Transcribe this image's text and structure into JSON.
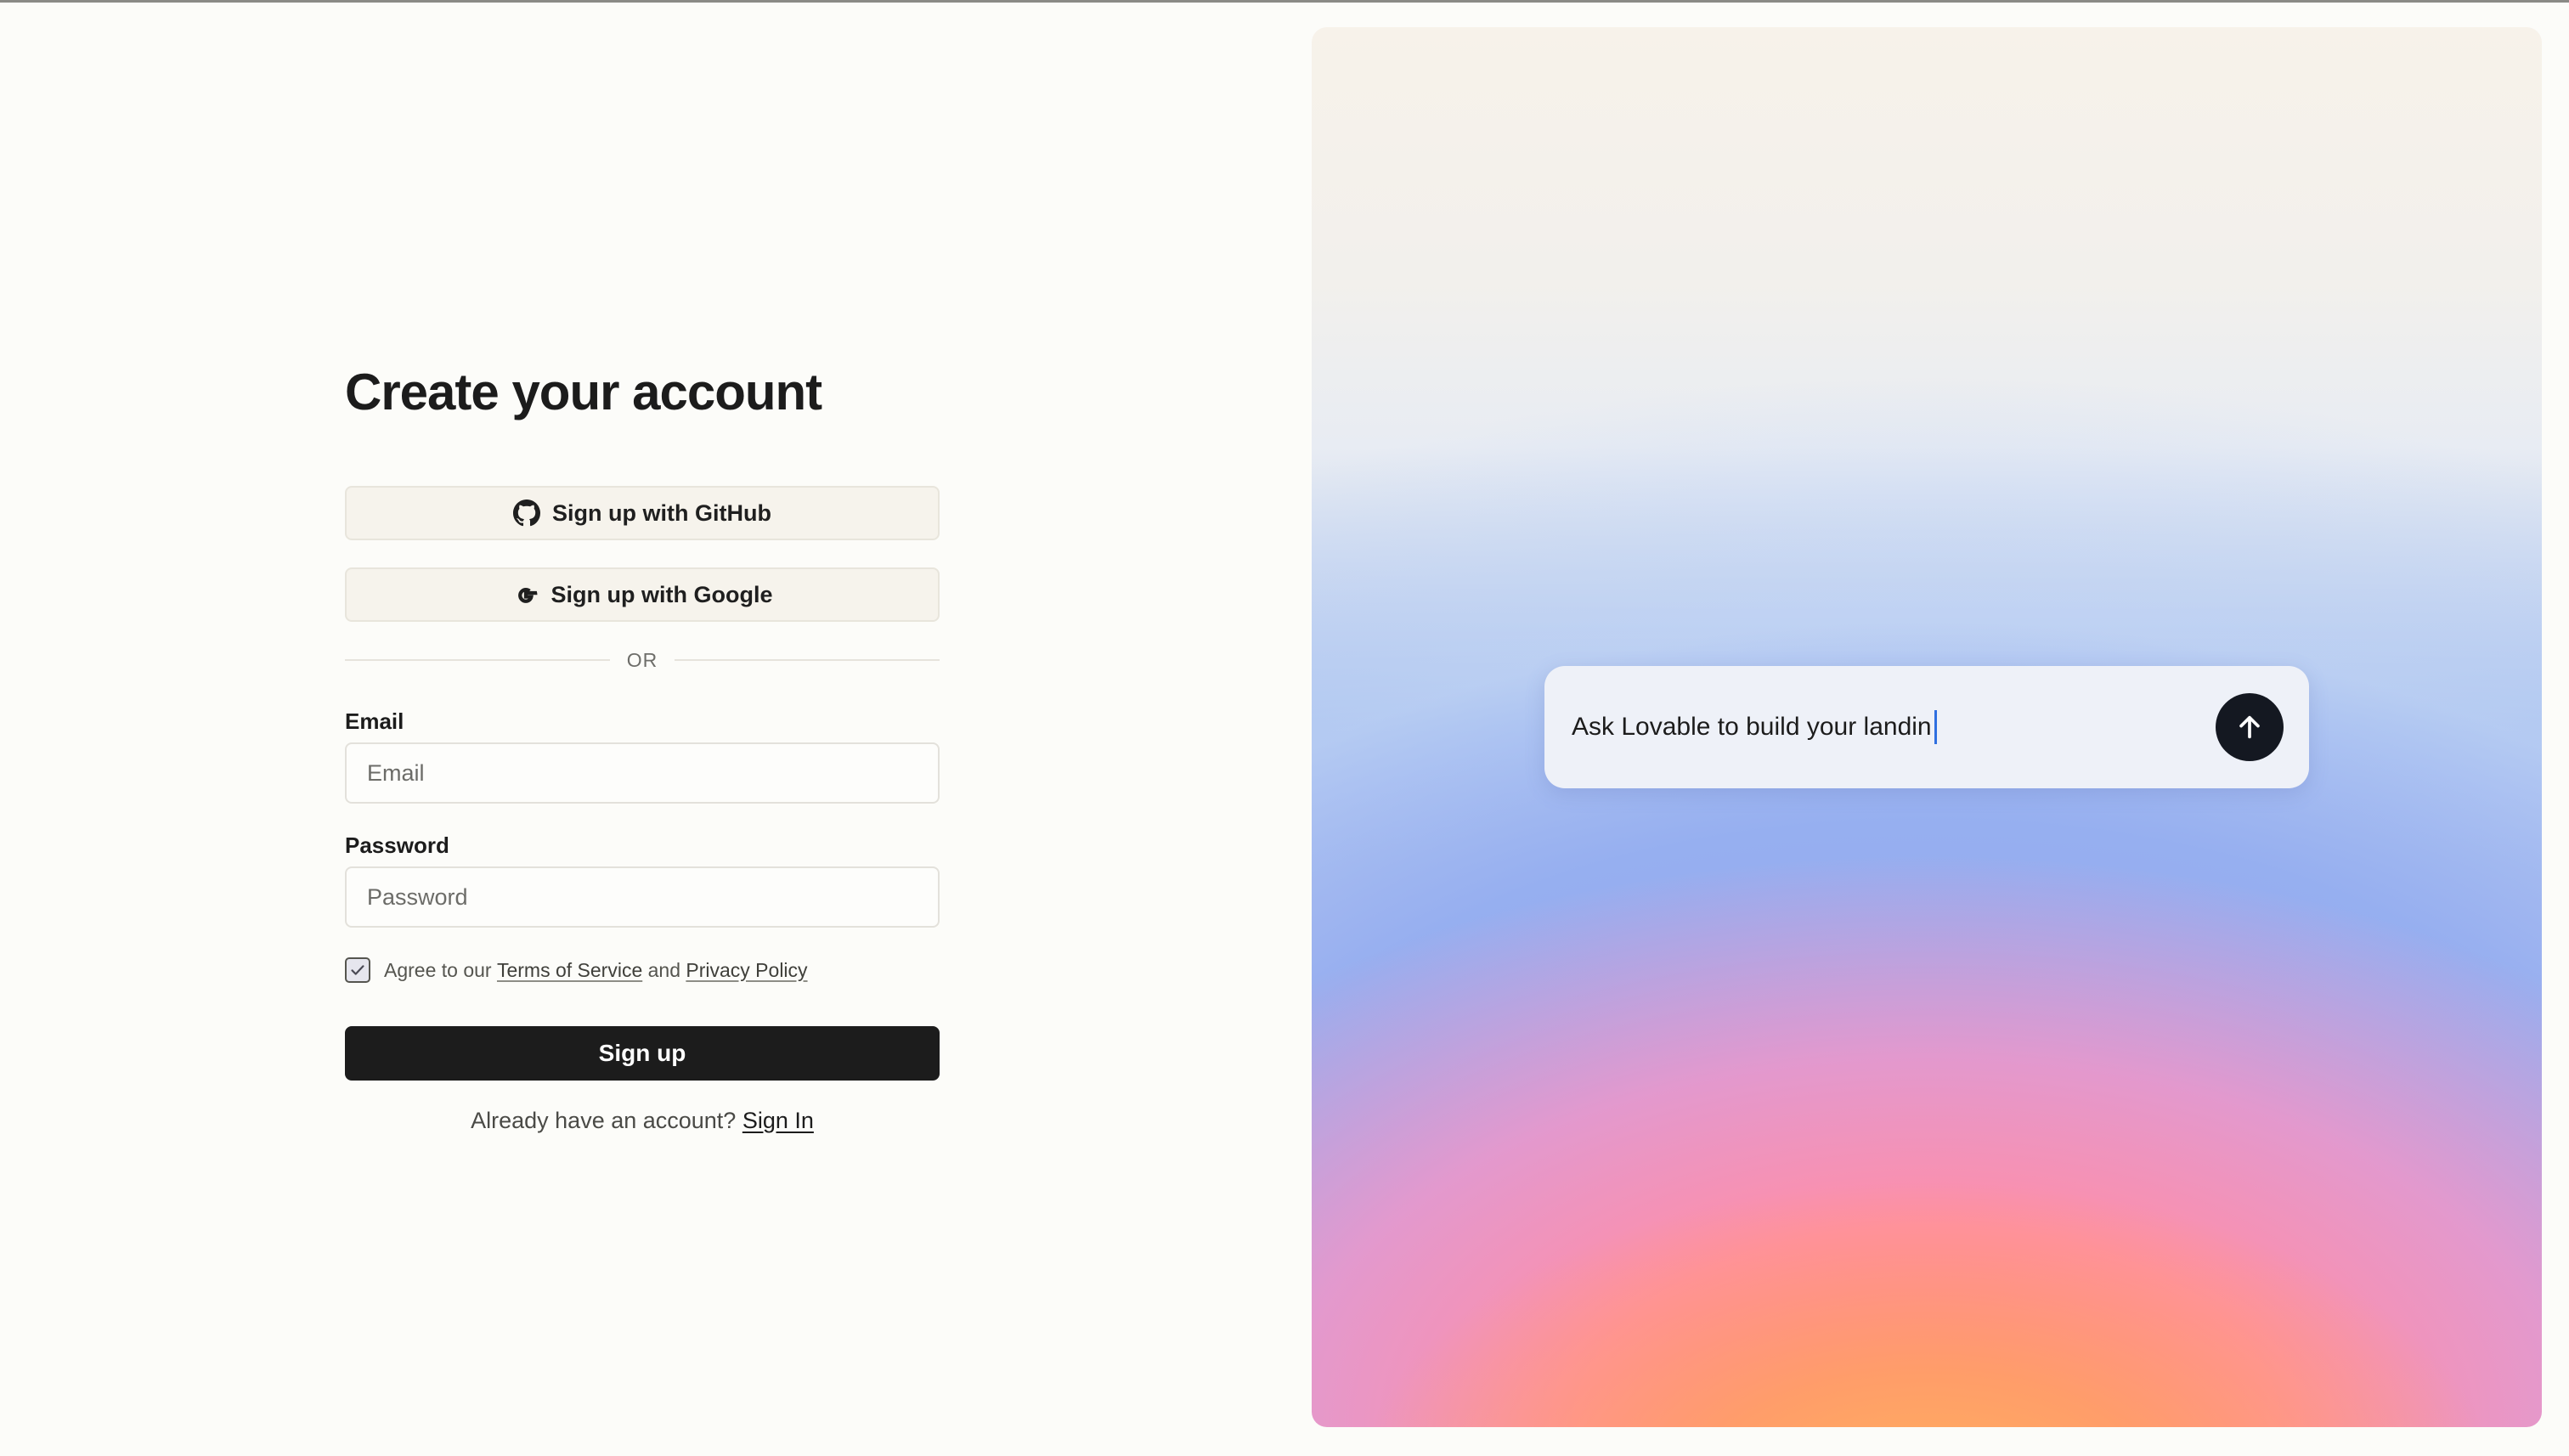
{
  "form": {
    "title": "Create your account",
    "github_label": "Sign up with GitHub",
    "google_label": "Sign up with Google",
    "divider_text": "OR",
    "email_label": "Email",
    "email_placeholder": "Email",
    "password_label": "Password",
    "password_placeholder": "Password",
    "agree_prefix": "Agree to our ",
    "terms_label": "Terms of Service",
    "agree_and": " and ",
    "privacy_label": "Privacy Policy",
    "agree_checked": true,
    "submit_label": "Sign up",
    "signin_prompt": "Already have an account? ",
    "signin_link": "Sign In"
  },
  "hero": {
    "prompt_text": "Ask Lovable to build your landin"
  },
  "icons": {
    "github": "github-icon",
    "google": "google-icon",
    "check": "check-icon",
    "send": "arrow-up-icon"
  },
  "colors": {
    "page_bg": "#fcfcf9",
    "primary_button": "#1c1c1c",
    "oauth_button_bg": "#f6f3ec",
    "send_button": "#141821",
    "caret": "#2f6fe0"
  }
}
